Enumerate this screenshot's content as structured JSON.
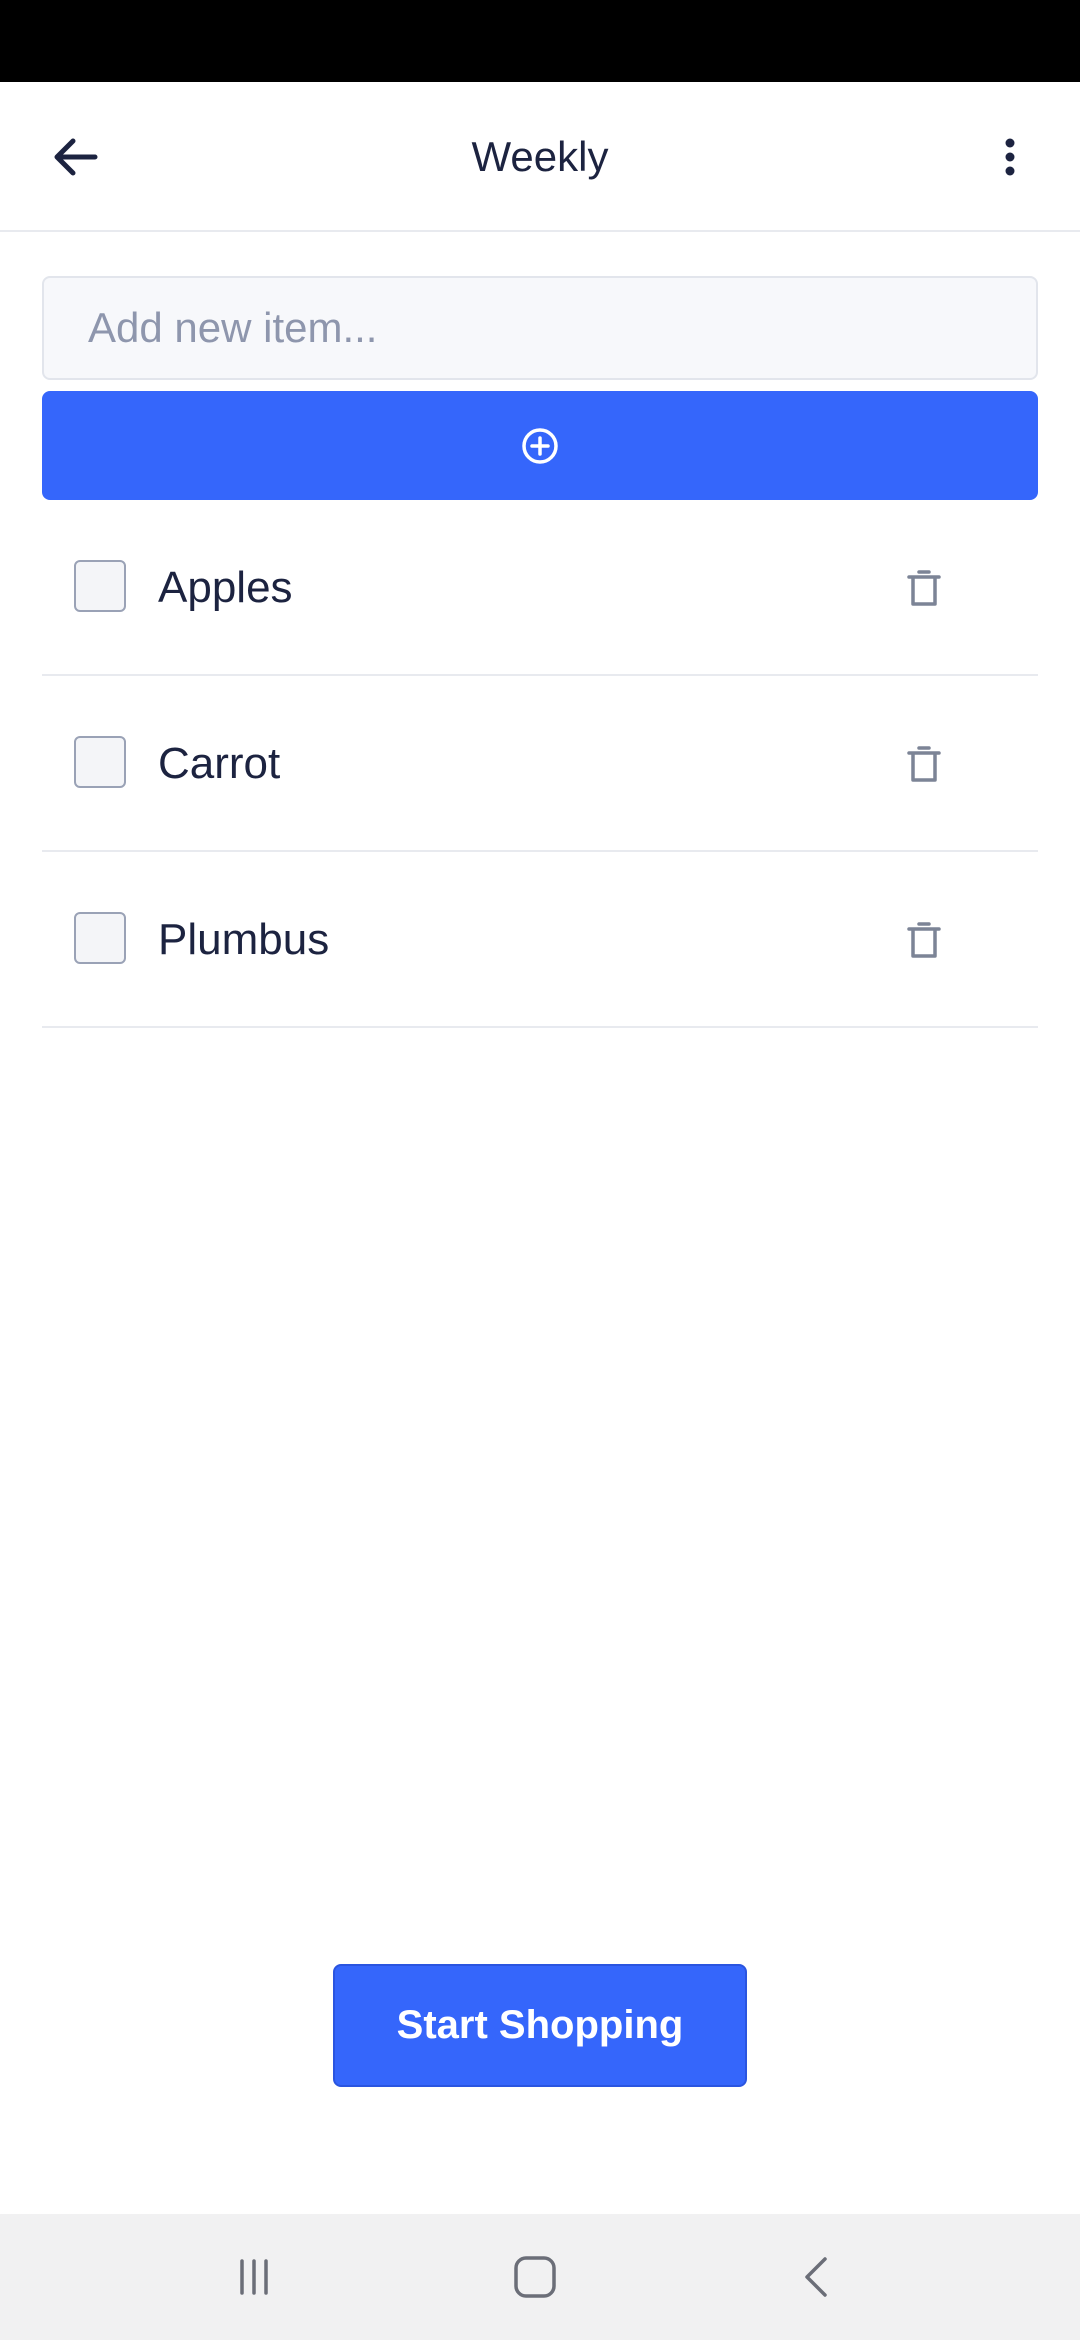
{
  "header": {
    "title": "Weekly",
    "back_icon": "arrow-left-icon",
    "menu_icon": "more-vertical-icon"
  },
  "add_item": {
    "placeholder": "Add new item...",
    "value": "",
    "button_icon": "plus-circle-icon"
  },
  "items": [
    {
      "label": "Apples",
      "checked": false
    },
    {
      "label": "Carrot",
      "checked": false
    },
    {
      "label": "Plumbus",
      "checked": false
    }
  ],
  "start_button": {
    "label": "Start Shopping"
  },
  "nav_bar": {
    "recents_icon": "recents-icon",
    "home_icon": "home-icon",
    "back_icon": "back-chevron-icon"
  },
  "colors": {
    "accent": "#3566fb",
    "text": "#1c2340",
    "muted": "#8e96ad",
    "status_bar": "#000000",
    "nav_bar": "#f1f1f2"
  }
}
